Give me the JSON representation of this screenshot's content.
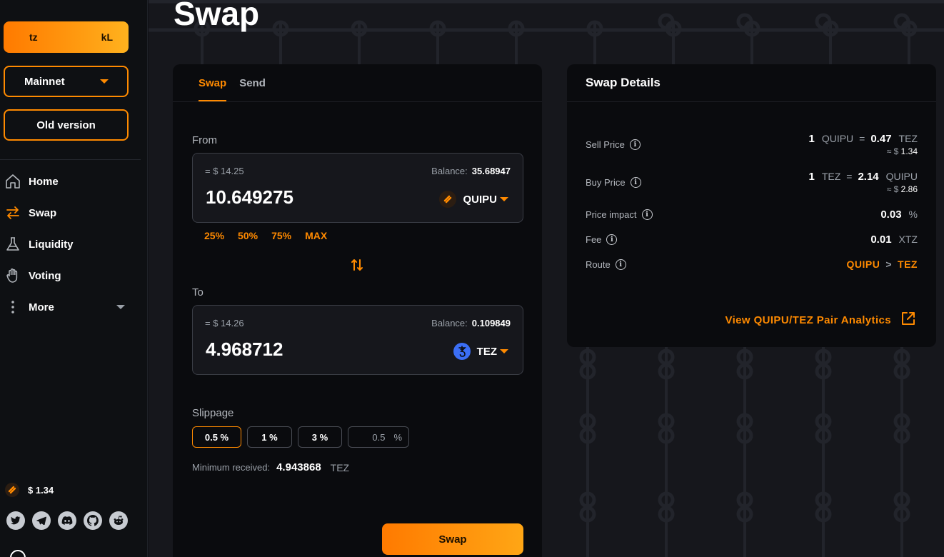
{
  "sidebar": {
    "wallet": {
      "left": "tz",
      "right": "kL"
    },
    "network": "Mainnet",
    "old_version": "Old version",
    "nav": [
      {
        "label": "Home",
        "icon": "home-icon"
      },
      {
        "label": "Swap",
        "icon": "swap-icon"
      },
      {
        "label": "Liquidity",
        "icon": "flask-icon"
      },
      {
        "label": "Voting",
        "icon": "hand-icon"
      },
      {
        "label": "More",
        "icon": "more-icon"
      }
    ],
    "token_price": "$ 1.34",
    "socials": [
      "twitter-icon",
      "telegram-icon",
      "discord-icon",
      "github-icon",
      "reddit-icon"
    ]
  },
  "page": {
    "title": "Swap"
  },
  "swap_form": {
    "tabs": [
      "Swap",
      "Send"
    ],
    "active_tab": "Swap",
    "from": {
      "label": "From",
      "usd": "= $ 14.25",
      "balance_label": "Balance:",
      "balance": "35.68947",
      "amount": "10.649275",
      "token": "QUIPU"
    },
    "percent_buttons": [
      "25%",
      "50%",
      "75%",
      "MAX"
    ],
    "to": {
      "label": "To",
      "usd": "= $ 14.26",
      "balance_label": "Balance:",
      "balance": "0.109849",
      "amount": "4.968712",
      "token": "TEZ"
    },
    "slippage": {
      "label": "Slippage",
      "options": [
        "0.5 %",
        "1 %",
        "3 %"
      ],
      "selected": "0.5 %",
      "custom_placeholder": "0.5",
      "custom_unit": "%"
    },
    "min_received": {
      "label": "Minimum received:",
      "value": "4.943868",
      "unit": "TEZ"
    },
    "submit": "Swap"
  },
  "details": {
    "title": "Swap Details",
    "sell_price": {
      "label": "Sell Price",
      "a": "1",
      "a_token": "QUIPU",
      "eq": "=",
      "b": "0.47",
      "b_token": "TEZ",
      "usd_prefix": "≈ $",
      "usd": "1.34"
    },
    "buy_price": {
      "label": "Buy Price",
      "a": "1",
      "a_token": "TEZ",
      "eq": "=",
      "b": "2.14",
      "b_token": "QUIPU",
      "usd_prefix": "≈ $",
      "usd": "2.86"
    },
    "price_impact": {
      "label": "Price impact",
      "value": "0.03",
      "unit": "%"
    },
    "fee": {
      "label": "Fee",
      "value": "0.01",
      "unit": "XTZ"
    },
    "route": {
      "label": "Route",
      "from": "QUIPU",
      "sep": ">",
      "to": "TEZ"
    },
    "analytics_link": "View QUIPU/TEZ Pair Analytics"
  },
  "colors": {
    "accent": "#ff8a00",
    "bg": "#0f1014",
    "card": "#0a0b0e",
    "tez_blue": "#3b6ef5"
  }
}
